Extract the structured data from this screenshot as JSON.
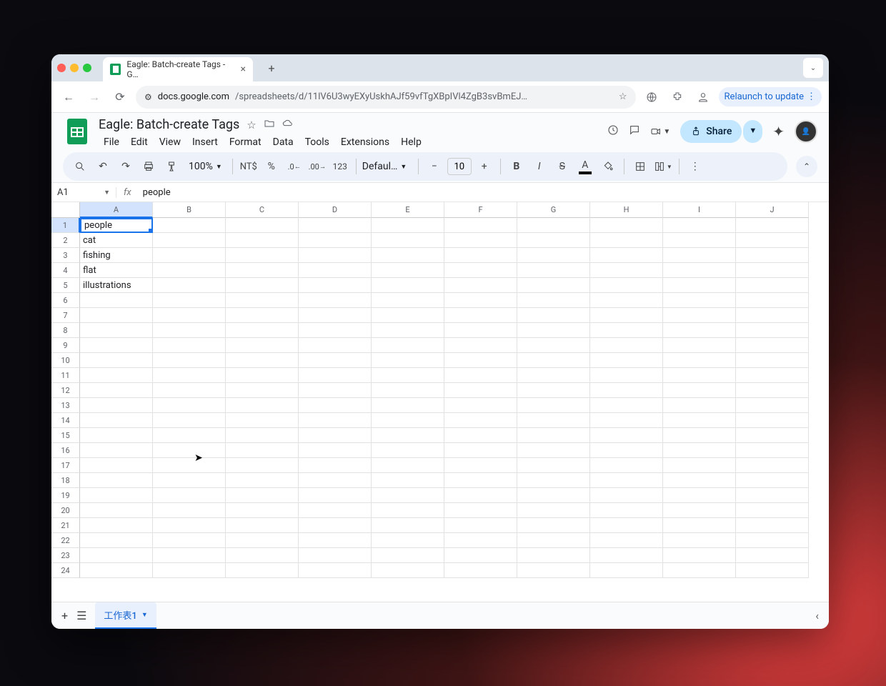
{
  "browser": {
    "tab_title": "Eagle: Batch-create Tags - G…",
    "url_prefix": "docs.google.com",
    "url_path": "/spreadsheets/d/11lV6U3wyEXyUskhAJf59vfTgXBpIVl4ZgB3svBmEJ…",
    "relaunch": "Relaunch to update"
  },
  "doc": {
    "title": "Eagle: Batch-create Tags",
    "menu": [
      "File",
      "Edit",
      "View",
      "Insert",
      "Format",
      "Data",
      "Tools",
      "Extensions",
      "Help"
    ],
    "share": "Share"
  },
  "toolbar": {
    "zoom": "100%",
    "currency": "NT$",
    "percent": "%",
    "format123": "123",
    "font": "Defaul…",
    "font_size": "10"
  },
  "namebox": "A1",
  "formula": "people",
  "columns": [
    "A",
    "B",
    "C",
    "D",
    "E",
    "F",
    "G",
    "H",
    "I",
    "J"
  ],
  "rows": 24,
  "selected_cell": {
    "row": 0,
    "col": 0
  },
  "data": {
    "A1": "people",
    "A2": "cat",
    "A3": "fishing",
    "A4": "flat",
    "A5": "illustrations"
  },
  "sheet_tab": "工作表1"
}
